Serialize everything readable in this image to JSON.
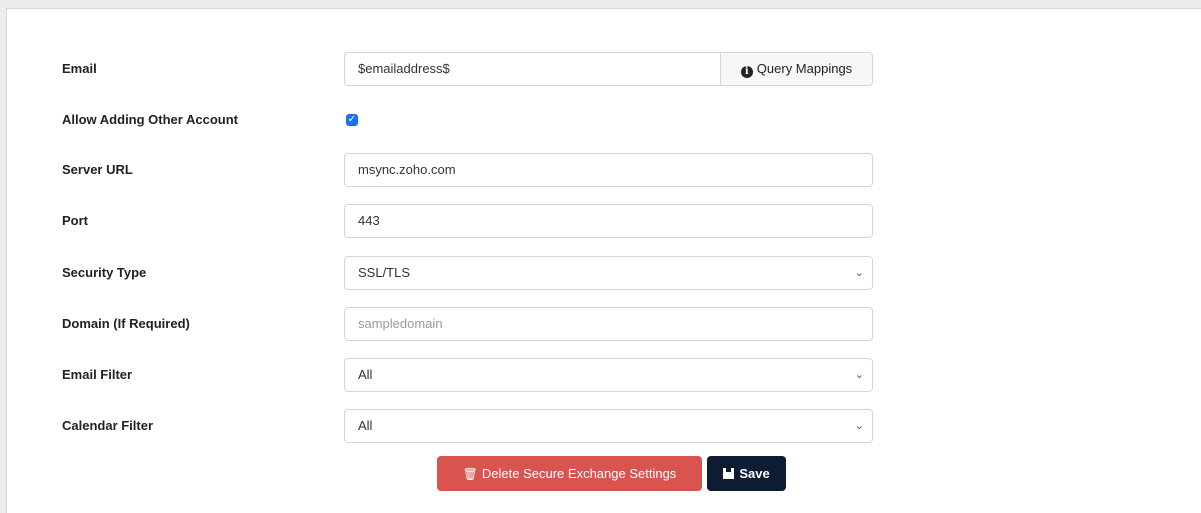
{
  "form": {
    "email": {
      "label": "Email",
      "value": "$emailaddress$",
      "addon_label": "Query Mappings"
    },
    "allow_adding": {
      "label": "Allow Adding Other Account",
      "checked": true
    },
    "server_url": {
      "label": "Server URL",
      "value": "msync.zoho.com"
    },
    "port": {
      "label": "Port",
      "value": "443"
    },
    "security_type": {
      "label": "Security Type",
      "value": "SSL/TLS"
    },
    "domain": {
      "label": "Domain (If Required)",
      "placeholder": "sampledomain"
    },
    "email_filter": {
      "label": "Email Filter",
      "value": "All"
    },
    "calendar_filter": {
      "label": "Calendar Filter",
      "value": "All"
    }
  },
  "actions": {
    "delete_label": "Delete Secure Exchange Settings",
    "save_label": "Save"
  },
  "colors": {
    "delete_button": "#d9534f",
    "save_button": "#0d1b33",
    "checkbox": "#1a73e8"
  },
  "icons": {
    "info": "info-circle-icon",
    "trash": "trash-icon",
    "save": "floppy-disk-icon",
    "caret": "chevron-down-icon"
  }
}
